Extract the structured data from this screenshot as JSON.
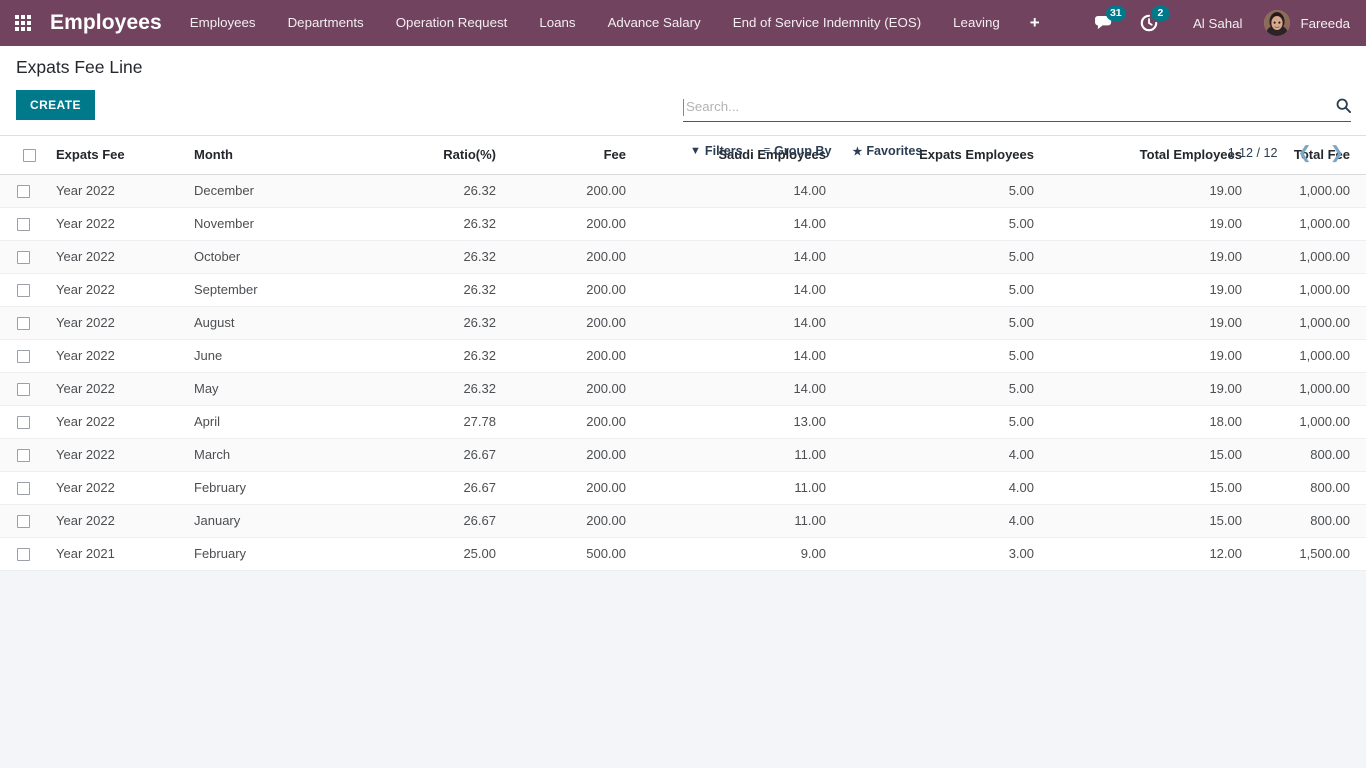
{
  "navbar": {
    "apps_icon": "apps-grid-icon",
    "brand": "Employees",
    "menu": [
      {
        "label": "Employees"
      },
      {
        "label": "Departments"
      },
      {
        "label": "Operation Request"
      },
      {
        "label": "Loans"
      },
      {
        "label": "Advance Salary"
      },
      {
        "label": "End of Service Indemnity (EOS)"
      },
      {
        "label": "Leaving"
      }
    ],
    "plus_label": "+",
    "messages": {
      "icon": "chat-bubble-icon",
      "count": "31"
    },
    "activities": {
      "icon": "clock-activity-icon",
      "count": "2"
    },
    "company": "Al Sahal",
    "user": "Fareeda",
    "colors": {
      "navbar_bg": "#71435f",
      "badge_bg": "#00798a"
    }
  },
  "control_panel": {
    "title": "Expats Fee Line",
    "create_label": "CREATE",
    "search": {
      "placeholder": "Search...",
      "value": "",
      "icon": "search-icon"
    },
    "buttons": [
      {
        "label": "Filters",
        "icon": "filter-icon",
        "glyph": "▼"
      },
      {
        "label": "Group By",
        "icon": "group-by-icon",
        "glyph": "≡"
      },
      {
        "label": "Favorites",
        "icon": "star-icon",
        "glyph": "★"
      }
    ],
    "pager": {
      "range": "1-12 / 12",
      "prev_icon": "chevron-left-icon",
      "next_icon": "chevron-right-icon"
    },
    "accent_color": "#00798a"
  },
  "table": {
    "select_all_icon": "checkbox-select-all",
    "columns": [
      "Expats Fee",
      "Month",
      "Ratio(%)",
      "Fee",
      "Saudi Employees",
      "Expats Employees",
      "Total Employees",
      "Total Fee"
    ],
    "rows": [
      {
        "expats_fee": "Year 2022",
        "month": "December",
        "ratio": "26.32",
        "fee": "200.00",
        "saudi": "14.00",
        "expats": "5.00",
        "total_employees": "19.00",
        "total_fee": "1,000.00"
      },
      {
        "expats_fee": "Year 2022",
        "month": "November",
        "ratio": "26.32",
        "fee": "200.00",
        "saudi": "14.00",
        "expats": "5.00",
        "total_employees": "19.00",
        "total_fee": "1,000.00"
      },
      {
        "expats_fee": "Year 2022",
        "month": "October",
        "ratio": "26.32",
        "fee": "200.00",
        "saudi": "14.00",
        "expats": "5.00",
        "total_employees": "19.00",
        "total_fee": "1,000.00"
      },
      {
        "expats_fee": "Year 2022",
        "month": "September",
        "ratio": "26.32",
        "fee": "200.00",
        "saudi": "14.00",
        "expats": "5.00",
        "total_employees": "19.00",
        "total_fee": "1,000.00"
      },
      {
        "expats_fee": "Year 2022",
        "month": "August",
        "ratio": "26.32",
        "fee": "200.00",
        "saudi": "14.00",
        "expats": "5.00",
        "total_employees": "19.00",
        "total_fee": "1,000.00"
      },
      {
        "expats_fee": "Year 2022",
        "month": "June",
        "ratio": "26.32",
        "fee": "200.00",
        "saudi": "14.00",
        "expats": "5.00",
        "total_employees": "19.00",
        "total_fee": "1,000.00"
      },
      {
        "expats_fee": "Year 2022",
        "month": "May",
        "ratio": "26.32",
        "fee": "200.00",
        "saudi": "14.00",
        "expats": "5.00",
        "total_employees": "19.00",
        "total_fee": "1,000.00"
      },
      {
        "expats_fee": "Year 2022",
        "month": "April",
        "ratio": "27.78",
        "fee": "200.00",
        "saudi": "13.00",
        "expats": "5.00",
        "total_employees": "18.00",
        "total_fee": "1,000.00"
      },
      {
        "expats_fee": "Year 2022",
        "month": "March",
        "ratio": "26.67",
        "fee": "200.00",
        "saudi": "11.00",
        "expats": "4.00",
        "total_employees": "15.00",
        "total_fee": "800.00"
      },
      {
        "expats_fee": "Year 2022",
        "month": "February",
        "ratio": "26.67",
        "fee": "200.00",
        "saudi": "11.00",
        "expats": "4.00",
        "total_employees": "15.00",
        "total_fee": "800.00"
      },
      {
        "expats_fee": "Year 2022",
        "month": "January",
        "ratio": "26.67",
        "fee": "200.00",
        "saudi": "11.00",
        "expats": "4.00",
        "total_employees": "15.00",
        "total_fee": "800.00"
      },
      {
        "expats_fee": "Year 2021",
        "month": "February",
        "ratio": "25.00",
        "fee": "500.00",
        "saudi": "9.00",
        "expats": "3.00",
        "total_employees": "12.00",
        "total_fee": "1,500.00"
      }
    ]
  }
}
